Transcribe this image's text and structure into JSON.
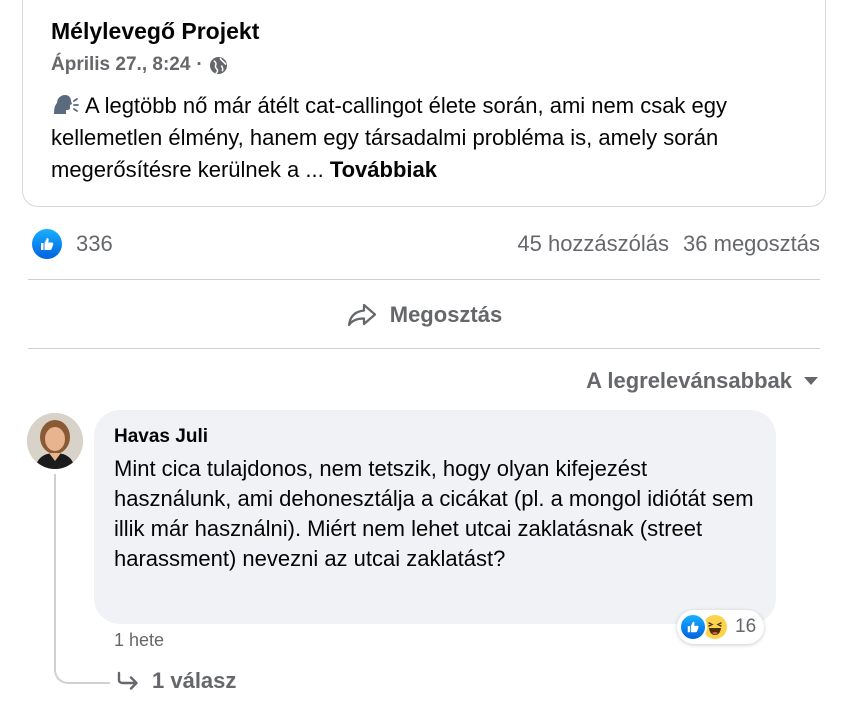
{
  "post": {
    "page_name": "Mélylevegő Projekt",
    "date": "Április 27., 8:24",
    "separator": "·",
    "audience_icon": "globe-icon",
    "text": "A legtöbb nő már átélt cat-callingot élete során, ami nem csak egy kellemetlen élmény, hanem egy társadalmi probléma is, amely során megerősítésre kerülnek a ...",
    "see_more": "Továbbiak"
  },
  "stats": {
    "like_count": "336",
    "comments": "45 hozzászólás",
    "shares": "36 megosztás"
  },
  "actions": {
    "share_label": "Megosztás"
  },
  "sort": {
    "label": "A legrelevánsabbak"
  },
  "comment": {
    "author": "Havas Juli",
    "text": "Mint cica tulajdonos, nem tetszik, hogy olyan kifejezést használunk, ami dehonesztálja a cicákat (pl. a mongol idiótát sem illik már használni). Miért nem lehet utcai zaklatásnak (street harassment) nevezni az utcai zaklatást?",
    "reaction_count": "16",
    "reactions": [
      "like-icon",
      "haha-icon"
    ],
    "time": "1 hete",
    "replies": "1 válasz"
  },
  "colors": {
    "text_primary": "#050505",
    "text_secondary": "#65676b",
    "bubble_bg": "#f0f2f5",
    "like_blue": "#0866ff",
    "divider": "#ced0d4"
  }
}
